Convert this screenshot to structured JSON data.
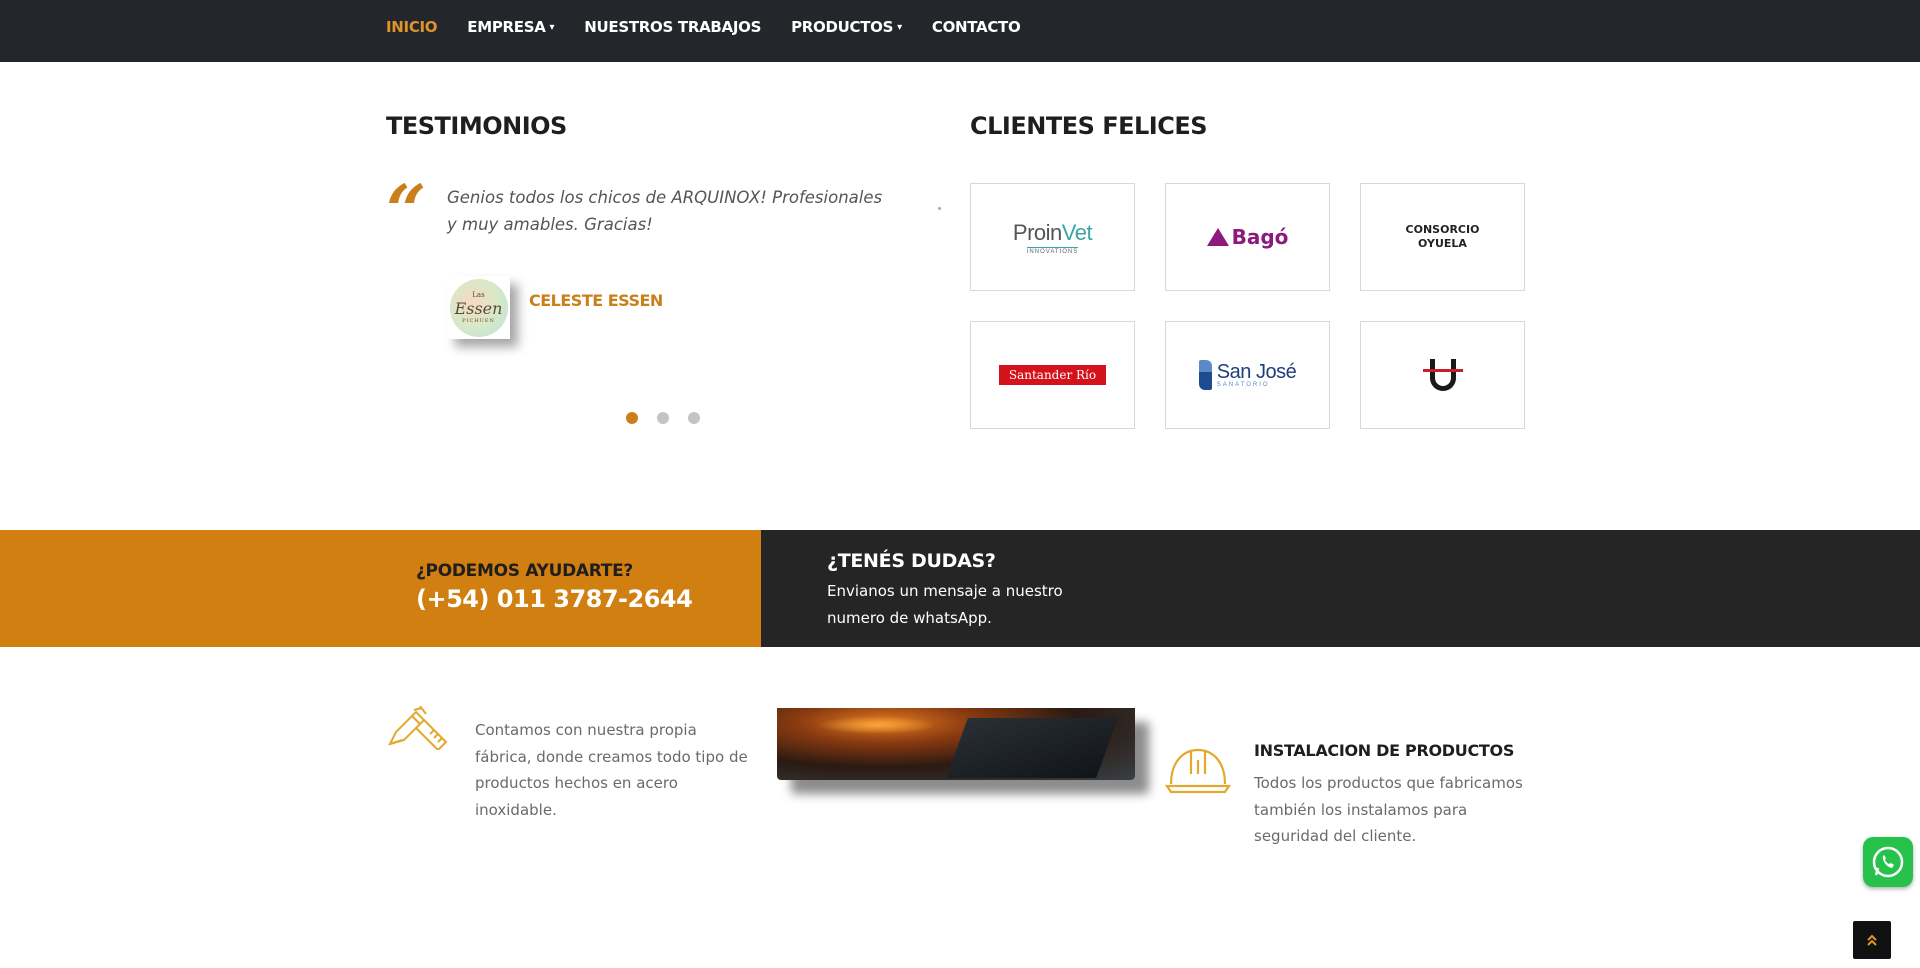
{
  "nav": {
    "items": [
      {
        "label": "INICIO",
        "active": true,
        "dropdown": false
      },
      {
        "label": "EMPRESA",
        "active": false,
        "dropdown": true
      },
      {
        "label": "NUESTROS TRABAJOS",
        "active": false,
        "dropdown": false
      },
      {
        "label": "PRODUCTOS",
        "active": false,
        "dropdown": true
      },
      {
        "label": "CONTACTO",
        "active": false,
        "dropdown": false
      }
    ],
    "chevron": "▾"
  },
  "testimonials": {
    "title": "TESTIMONIOS",
    "quote_mark": "“",
    "quote": "Genios todos los chicos de ARQUINOX! Profesionales y muy amables. Gracias!",
    "name": "CELESTE ESSEN",
    "avatar_logo": {
      "top": "Las",
      "main": "Essen",
      "bottom": "PICHUEN"
    },
    "slides": 3,
    "active_slide": 1
  },
  "clients": {
    "title": "CLIENTES FELICES",
    "logos": [
      {
        "name": "ProinVet",
        "text_a": "Proin",
        "text_b": "Vet",
        "sub": "INNOVATIONS"
      },
      {
        "name": "Bagó",
        "text": "Bagó"
      },
      {
        "name": "Consorcio Oyuela",
        "line1": "CONSORCIO",
        "line2": "OYUELA"
      },
      {
        "name": "Santander Río",
        "text": "Santander Río"
      },
      {
        "name": "San José",
        "text": "San José",
        "sub": "SANATORIO"
      },
      {
        "name": "U logo"
      }
    ]
  },
  "help": {
    "question": "¿PODEMOS AYUDARTE?",
    "phone": "(+54) 011 3787-2644",
    "dudas_title": "¿TENÉS DUDAS?",
    "dudas_text": "Envianos un mensaje a nuestro numero de whatsApp."
  },
  "features": {
    "fabrica_text": "Contamos con nuestra propia fábrica, donde creamos todo tipo de productos hechos en acero inoxidable.",
    "instalacion_title": "INSTALACION DE PRODUCTOS",
    "instalacion_text": "Todos los productos que fabricamos también los instalamos para seguridad del cliente."
  },
  "colors": {
    "accent": "#d07f10",
    "nav_bg": "#23272b",
    "dark_banner": "#252525",
    "whatsapp": "#27c24c"
  },
  "icons": [
    "quote-icon",
    "tools-icon",
    "hardhat-icon",
    "whatsapp-icon",
    "double-chevron-up-icon"
  ]
}
